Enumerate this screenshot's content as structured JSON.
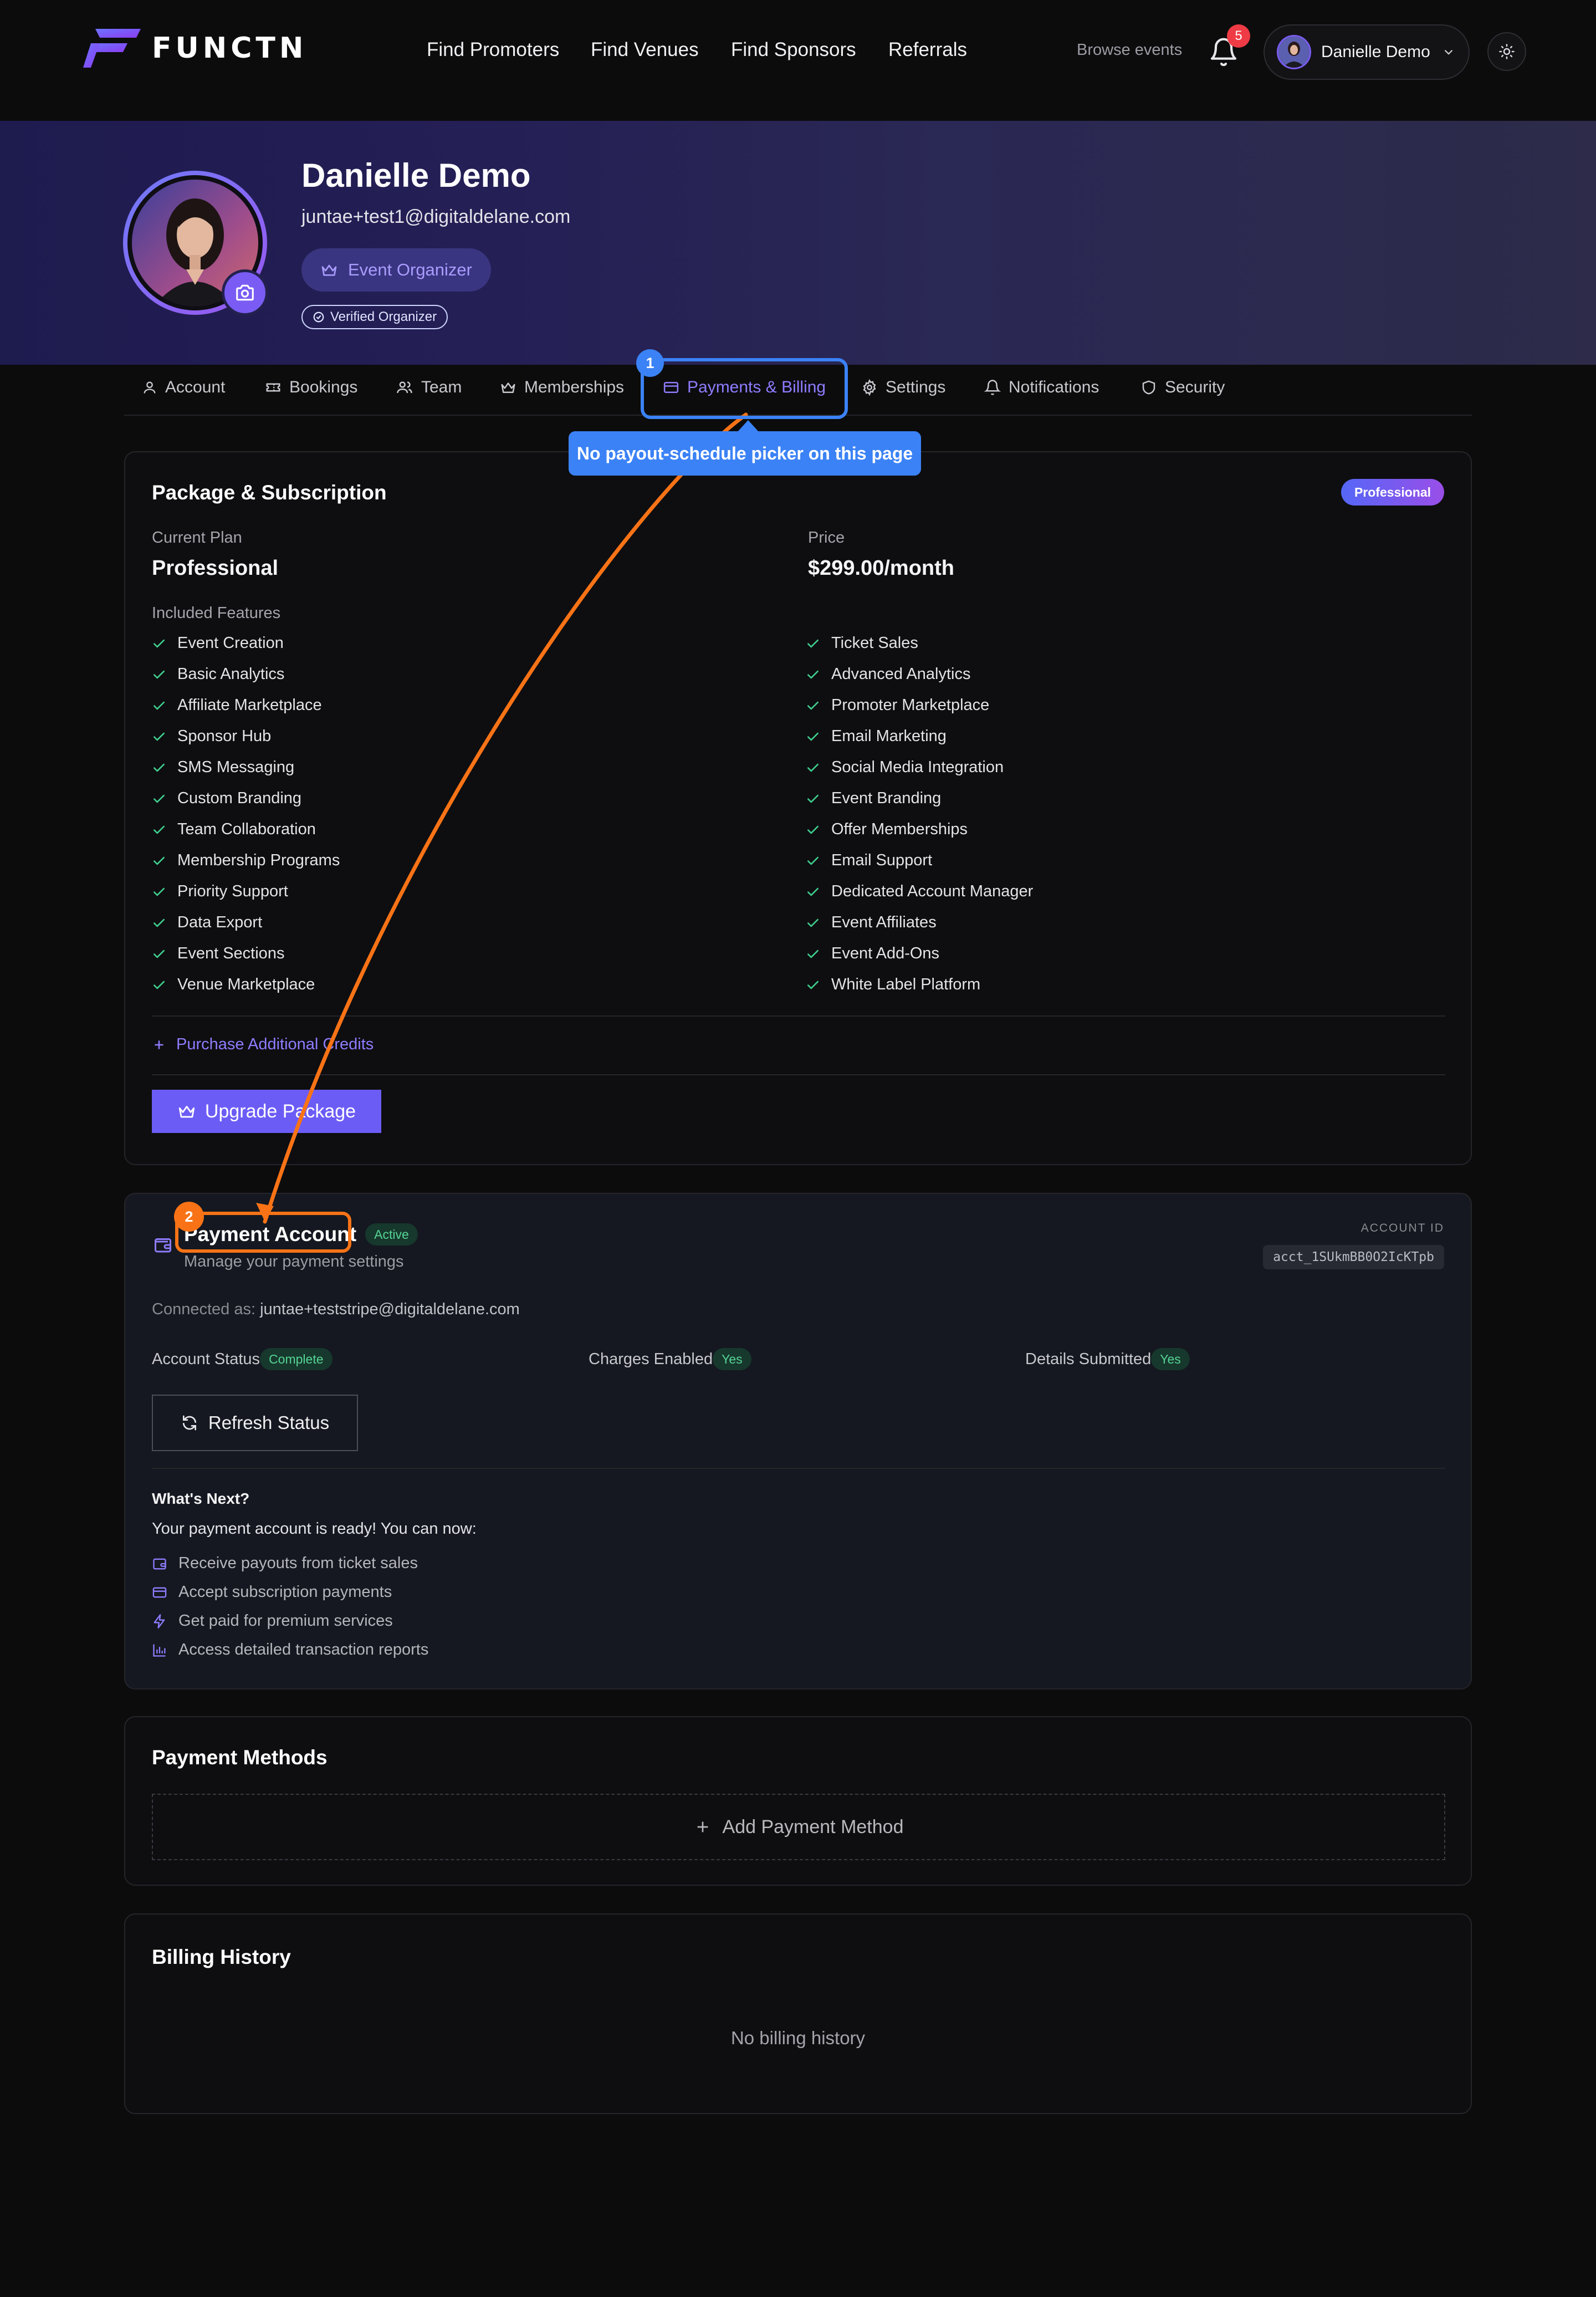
{
  "brand": {
    "name": "FUNCTN"
  },
  "nav": {
    "links": [
      "Find Promoters",
      "Find Venues",
      "Find Sponsors",
      "Referrals"
    ],
    "browse": "Browse events",
    "notification_count": "5",
    "user_name": "Danielle Demo"
  },
  "profile": {
    "name": "Danielle Demo",
    "email": "juntae+test1@digitaldelane.com",
    "role": "Event Organizer",
    "verified": "Verified Organizer"
  },
  "tabs": [
    {
      "label": "Account",
      "icon": "user-icon"
    },
    {
      "label": "Bookings",
      "icon": "ticket-icon"
    },
    {
      "label": "Team",
      "icon": "users-icon"
    },
    {
      "label": "Memberships",
      "icon": "crown-icon"
    },
    {
      "label": "Payments & Billing",
      "icon": "credit-card-icon",
      "active": true
    },
    {
      "label": "Settings",
      "icon": "gear-icon"
    },
    {
      "label": "Notifications",
      "icon": "bell-icon"
    },
    {
      "label": "Security",
      "icon": "shield-icon"
    }
  ],
  "annotations": {
    "step1": "1",
    "step2": "2",
    "callout": "No payout-schedule picker on this page",
    "colors": {
      "step1": "#3b82f6",
      "step2": "#f97316"
    }
  },
  "package": {
    "title": "Package & Subscription",
    "badge": "Professional",
    "current_plan_label": "Current Plan",
    "current_plan": "Professional",
    "price_label": "Price",
    "price": "$299.00/month",
    "features_label": "Included Features",
    "features_left": [
      "Event Creation",
      "Basic Analytics",
      "Affiliate Marketplace",
      "Sponsor Hub",
      "SMS Messaging",
      "Custom Branding",
      "Team Collaboration",
      "Membership Programs",
      "Priority Support",
      "Data Export",
      "Event Sections",
      "Venue Marketplace"
    ],
    "features_right": [
      "Ticket Sales",
      "Advanced Analytics",
      "Promoter Marketplace",
      "Email Marketing",
      "Social Media Integration",
      "Event Branding",
      "Offer Memberships",
      "Email Support",
      "Dedicated Account Manager",
      "Event Affiliates",
      "Event Add-Ons",
      "White Label Platform"
    ],
    "credits_link": "Purchase Additional Credits",
    "upgrade_button": "Upgrade Package"
  },
  "payment_account": {
    "title": "Payment Account",
    "status_pill": "Active",
    "subtitle": "Manage your payment settings",
    "account_id_label": "ACCOUNT ID",
    "account_id": "acct_1SUkmBB0O2IcKTpb",
    "connected_label": "Connected as:",
    "connected_email": "juntae+teststripe@digitaldelane.com",
    "account_status_label": "Account Status",
    "account_status": "Complete",
    "charges_label": "Charges Enabled",
    "charges": "Yes",
    "details_label": "Details Submitted",
    "details": "Yes",
    "refresh_button": "Refresh Status",
    "next_title": "What's Next?",
    "next_intro": "Your payment account is ready! You can now:",
    "next_items": [
      "Receive payouts from ticket sales",
      "Accept subscription payments",
      "Get paid for premium services",
      "Access detailed transaction reports"
    ]
  },
  "payment_methods": {
    "title": "Payment Methods",
    "add_button": "Add Payment Method"
  },
  "billing_history": {
    "title": "Billing History",
    "empty": "No billing history"
  }
}
